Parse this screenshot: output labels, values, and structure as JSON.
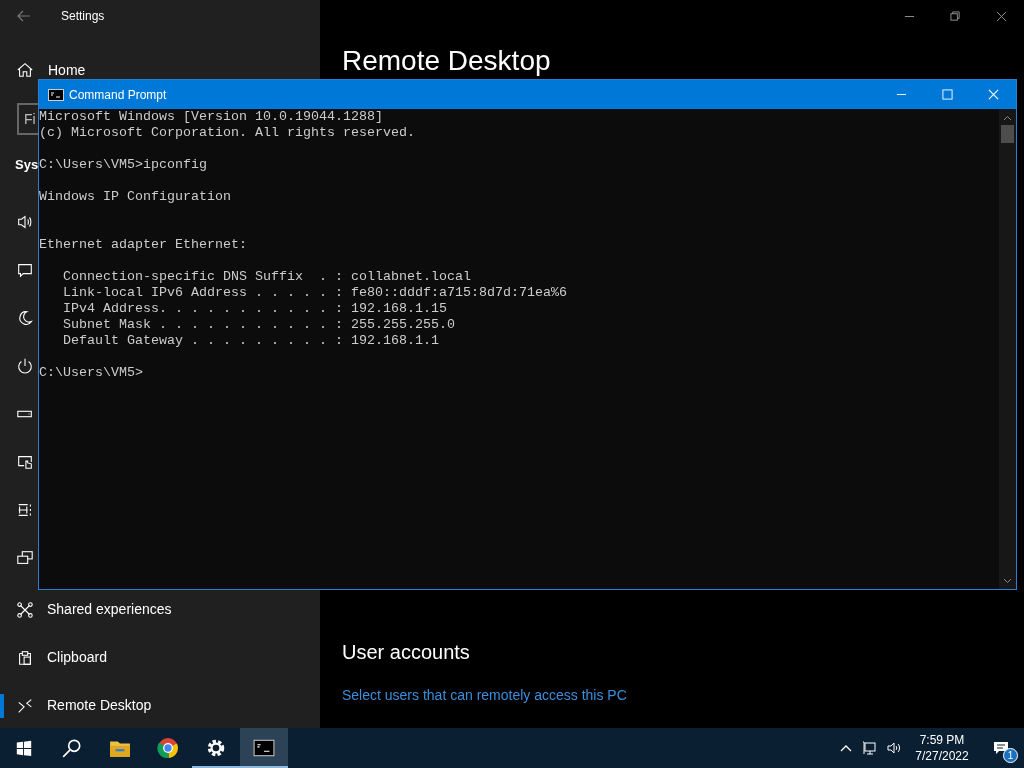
{
  "settings": {
    "title": "Settings",
    "home": "Home",
    "search_placeholder": "Fi",
    "section": "Sys",
    "items": [
      {
        "selected": false
      },
      {
        "selected": false
      },
      {
        "selected": false
      },
      {
        "selected": false
      },
      {
        "selected": false
      },
      {
        "selected": false
      },
      {
        "selected": false
      },
      {
        "selected": false
      },
      {
        "label": "Shared experiences",
        "selected": false
      },
      {
        "label": "Clipboard",
        "selected": false
      },
      {
        "label": "Remote Desktop",
        "selected": true
      }
    ],
    "page_title": "Remote Desktop",
    "user_accounts": "User accounts",
    "users_link": "Select users that can remotely access this PC"
  },
  "command_prompt": {
    "title": "Command Prompt",
    "lines": [
      {
        "kind": "text",
        "text": "Microsoft Windows [Version 10.0.19044.1288]"
      },
      {
        "kind": "text",
        "text": "(c) Microsoft Corporation. All rights reserved."
      },
      {
        "kind": "blank"
      },
      {
        "kind": "text",
        "text": "C:\\Users\\VM5>ipconfig"
      },
      {
        "kind": "blank"
      },
      {
        "kind": "text",
        "text": "Windows IP Configuration"
      },
      {
        "kind": "blank"
      },
      {
        "kind": "blank"
      },
      {
        "kind": "text",
        "text": "Ethernet adapter Ethernet:"
      },
      {
        "kind": "blank"
      },
      {
        "kind": "text",
        "text": "   Connection-specific DNS Suffix  . : collabnet.local"
      },
      {
        "kind": "text",
        "text": "   Link-local IPv6 Address . . . . . : fe80::dddf:a715:8d7d:71ea%6"
      },
      {
        "kind": "text",
        "text": "   IPv4 Address. . . . . . . . . . . : 192.168.1.15"
      },
      {
        "kind": "text",
        "text": "   Subnet Mask . . . . . . . . . . . : 255.255.255.0"
      },
      {
        "kind": "text",
        "text": "   Default Gateway . . . . . . . . . : 192.168.1.1"
      },
      {
        "kind": "blank"
      },
      {
        "kind": "text",
        "text": "C:\\Users\\VM5>"
      }
    ]
  },
  "taskbar": {
    "apps": [
      {
        "open": false,
        "active": false
      },
      {
        "open": false,
        "active": false
      },
      {
        "open": false,
        "active": false
      },
      {
        "open": true,
        "active": false
      },
      {
        "open": true,
        "active": true
      }
    ],
    "time": "7:59 PM",
    "date": "7/27/2022",
    "notifications": "1"
  }
}
